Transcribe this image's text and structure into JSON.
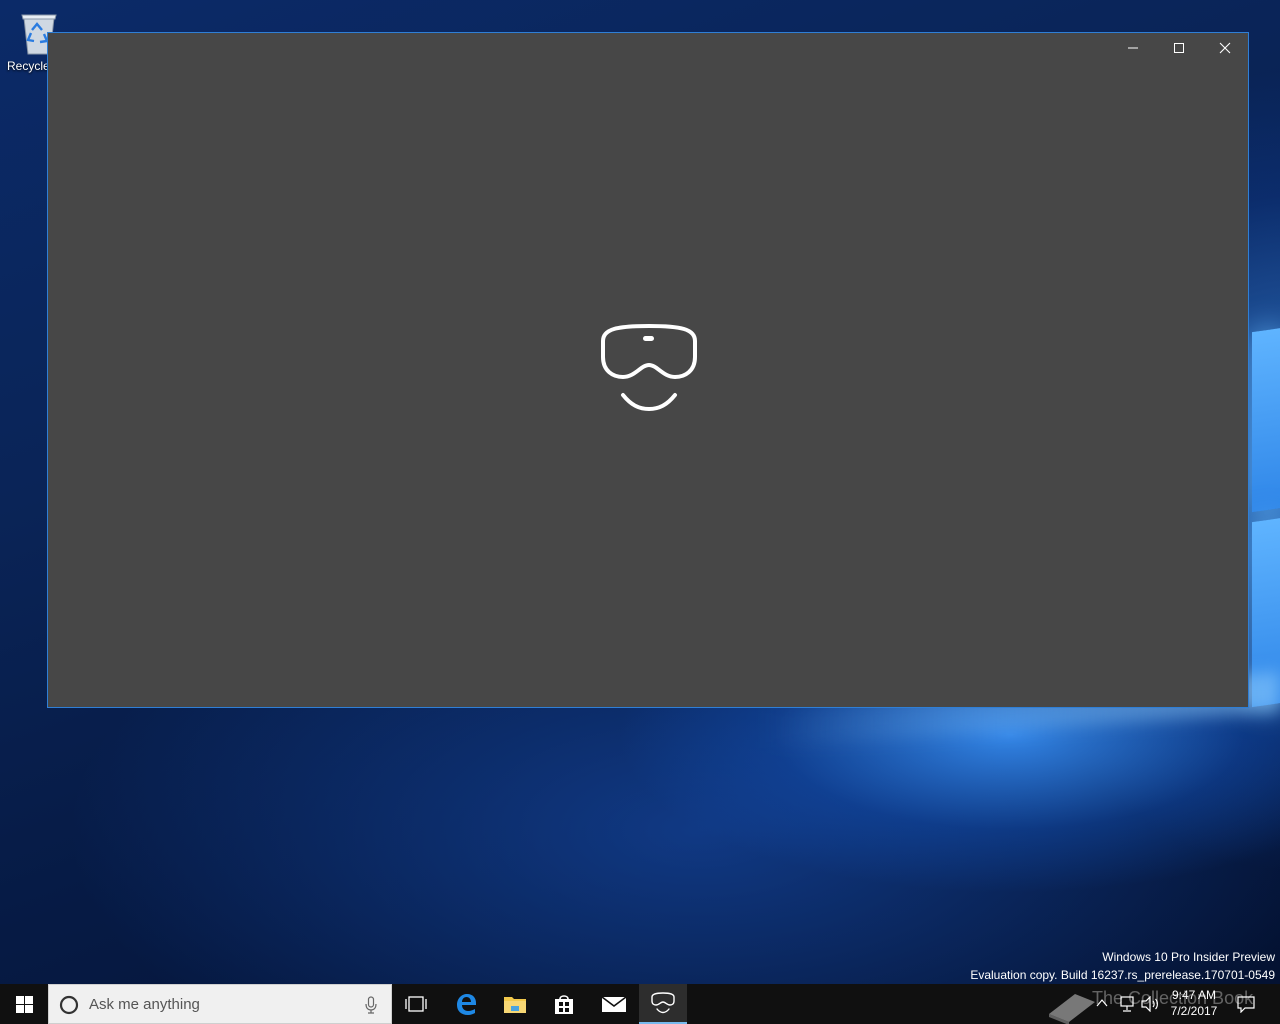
{
  "desktop": {
    "icons": [
      {
        "label": "Recycle",
        "icon": "recycle-bin-icon"
      }
    ]
  },
  "window": {
    "background": "#474747",
    "border_color": "#2f7fd6",
    "splash_icon": "mixed-reality-headset-icon",
    "caption_buttons": [
      {
        "icon": "minimize-icon"
      },
      {
        "icon": "maximize-icon"
      },
      {
        "icon": "close-icon"
      }
    ]
  },
  "watermark": {
    "line1": "Windows 10 Pro Insider Preview",
    "line2": "Evaluation copy. Build 16237.rs_prerelease.170701-0549"
  },
  "taskbar": {
    "search_placeholder": "Ask me anything",
    "apps": [
      {
        "icon": "task-view-icon"
      },
      {
        "icon": "edge-icon"
      },
      {
        "icon": "file-explorer-icon"
      },
      {
        "icon": "store-icon"
      },
      {
        "icon": "mail-icon"
      },
      {
        "icon": "mixed-reality-portal-icon",
        "active": true
      }
    ],
    "tray": {
      "overlay_text": "The Collection Book",
      "time": "9:47 AM",
      "date": "7/2/2017"
    },
    "accent": "#76b9ed"
  }
}
